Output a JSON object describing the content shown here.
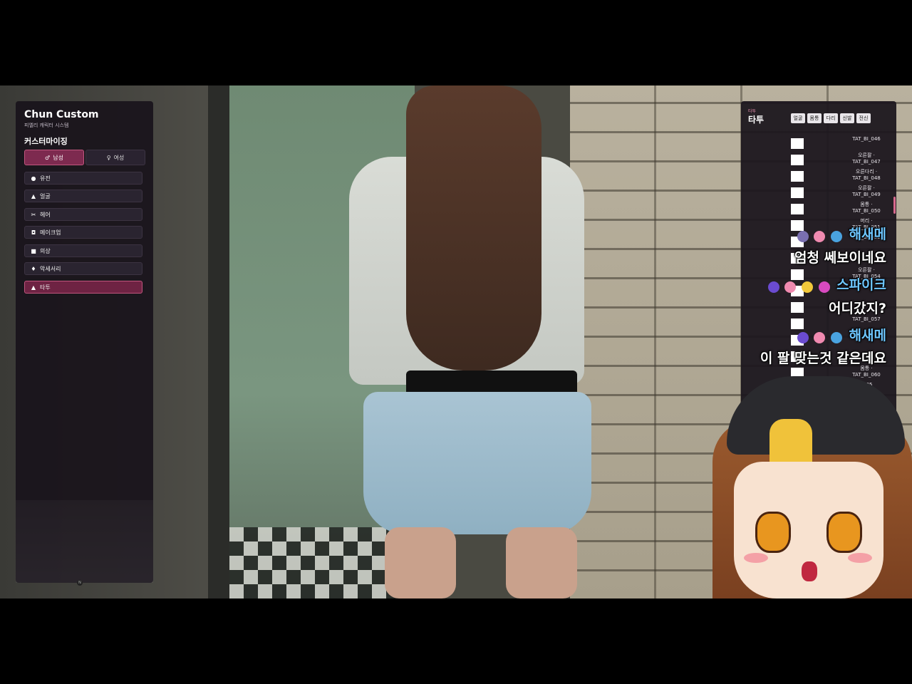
{
  "left_panel": {
    "title": "Chun Custom",
    "subtitle": "피엘리 캐릭터 시스템",
    "section_title": "커스터마이징",
    "gender": {
      "male_label": "남성",
      "female_label": "여성",
      "selected": "male"
    },
    "menu": [
      {
        "label": "유전",
        "icon": "person-icon"
      },
      {
        "label": "얼굴",
        "icon": "face-icon"
      },
      {
        "label": "헤어",
        "icon": "hair-icon"
      },
      {
        "label": "메이크업",
        "icon": "makeup-icon"
      },
      {
        "label": "의상",
        "icon": "shirt-icon"
      },
      {
        "label": "악세서리",
        "icon": "accessory-icon"
      },
      {
        "label": "타투",
        "icon": "tattoo-icon",
        "active": true
      }
    ],
    "footer_marker": "N"
  },
  "right_panel": {
    "small_label": "타투",
    "title": "타투",
    "tabs": [
      "얼굴",
      "몸통",
      "다리",
      "신발",
      "전신"
    ],
    "items": [
      {
        "line1": "",
        "line2": "TAT_BI_046"
      },
      {
        "line1": "오른팔 ·",
        "line2": "TAT_BI_047"
      },
      {
        "line1": "오른다리 ·",
        "line2": "TAT_BI_048"
      },
      {
        "line1": "오른팔 ·",
        "line2": "TAT_BI_049"
      },
      {
        "line1": "몸통 ·",
        "line2": "TAT_BI_050"
      },
      {
        "line1": "머리 ·",
        "line2": "TAT_BI_051"
      },
      {
        "line1": "",
        "line2": "TAT_BI_052"
      },
      {
        "line1": "",
        "line2": ""
      },
      {
        "line1": "오른팔 ·",
        "line2": "TAT_BI_054"
      },
      {
        "line1": "",
        "line2": ""
      },
      {
        "line1": "",
        "line2": ""
      },
      {
        "line1": "",
        "line2": "TAT_BI_057"
      },
      {
        "line1": "",
        "line2": ""
      },
      {
        "line1": "",
        "line2": ""
      },
      {
        "line1": "몸통 ·",
        "line2": "TAT_BI_060"
      },
      {
        "line1": "",
        "line2": "_005"
      }
    ]
  },
  "chat": [
    {
      "name": "해새메",
      "message": "엄청 쎄보이네요"
    },
    {
      "name": "스파이크",
      "message": "어디갔지?"
    },
    {
      "name": "해새메",
      "message": "이 팔 맞는것 같은데요"
    }
  ],
  "colors": {
    "accent": "#7d2a4f",
    "chat_name": "#6ec6ff"
  }
}
